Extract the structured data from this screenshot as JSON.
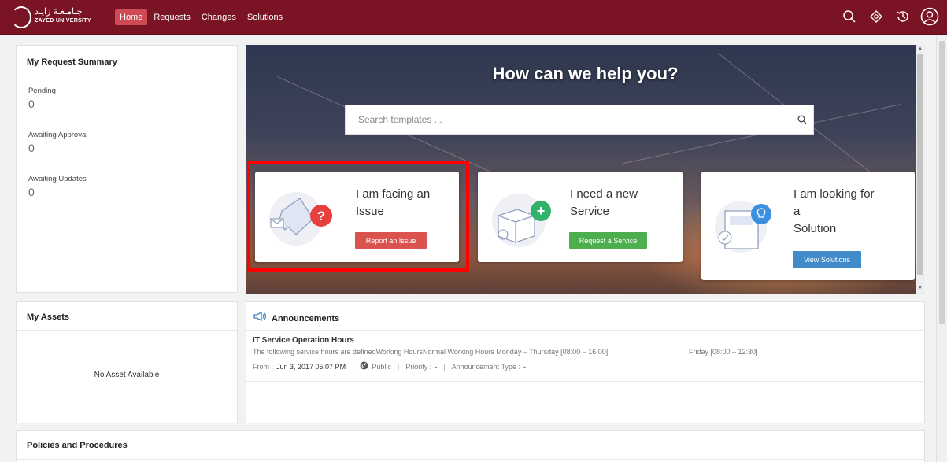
{
  "logo": {
    "arabic": "جـامـعـة زايـد",
    "english": "ZAYED UNIVERSITY"
  },
  "nav": {
    "items": [
      "Home",
      "Requests",
      "Changes",
      "Solutions"
    ],
    "active": "Home"
  },
  "colors": {
    "brand": "#7a1424",
    "report_button": "#d9534f",
    "request_button": "#4cae4c",
    "solutions_button": "#428bca",
    "highlight": "#ff0000"
  },
  "summary": {
    "title": "My Request Summary",
    "items": [
      {
        "label": "Pending",
        "value": "0"
      },
      {
        "label": "Awaiting Approval",
        "value": "0"
      },
      {
        "label": "Awaiting Updates",
        "value": "0"
      }
    ]
  },
  "hero": {
    "heading": "How can we help you?",
    "search_placeholder": "Search templates ...",
    "options": [
      {
        "title_line1": "I am facing an",
        "title_line2": "Issue",
        "title_line3": "",
        "button": "Report an Issue"
      },
      {
        "title_line1": "I need a new",
        "title_line2": "Service",
        "title_line3": "",
        "button": "Request a Service"
      },
      {
        "title_line1": "I am looking for",
        "title_line2": "a",
        "title_line3": "Solution",
        "button": "View Solutions"
      }
    ]
  },
  "assets": {
    "title": "My Assets",
    "empty": "No Asset Available"
  },
  "announcements": {
    "title": "Announcements",
    "item": {
      "title": "IT Service Operation Hours",
      "description": "The following service hours are definedWorking HoursNormal Working Hours  Monday – Thursday [08:00 – 16:00]",
      "description_friday": "Friday [08:00 – 12:30]",
      "from_label": "From :",
      "from_value": "Jun 3, 2017 05:07 PM",
      "visibility": "Public",
      "priority_label": "Priority :",
      "priority_value": "-",
      "type_label": "Announcement Type :",
      "type_value": "-"
    }
  },
  "policies": {
    "title": "Policies and Procedures"
  }
}
